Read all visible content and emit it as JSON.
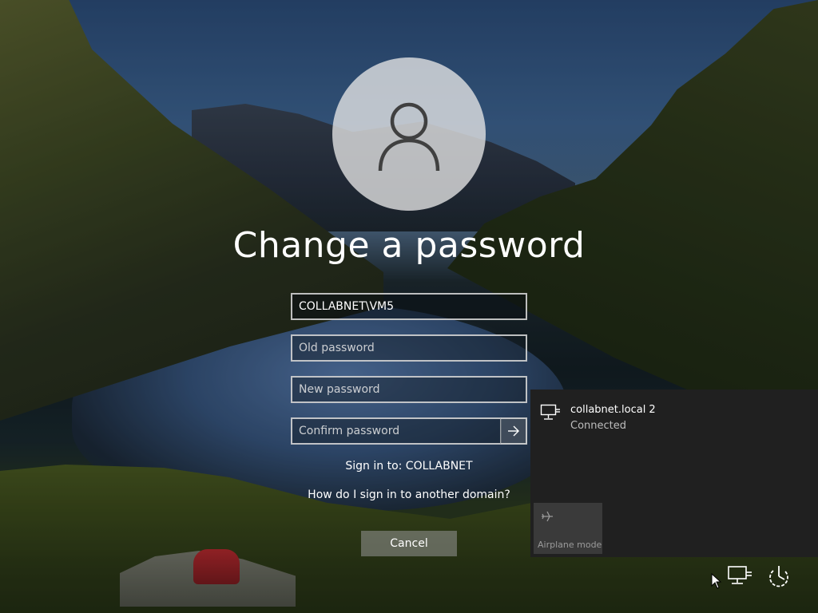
{
  "title": "Change a password",
  "form": {
    "username_value": "COLLABNET\\VM5",
    "old_password_placeholder": "Old password",
    "new_password_placeholder": "New password",
    "confirm_password_placeholder": "Confirm password",
    "submit_icon": "arrow-right-icon"
  },
  "sign_in_to": "Sign in to: COLLABNET",
  "domain_help_link": "How do I sign in to another domain?",
  "cancel_label": "Cancel",
  "network_flyout": {
    "network_name": "collabnet.local 2",
    "network_status": "Connected",
    "network_icon": "ethernet-icon",
    "airplane_mode_label": "Airplane mode",
    "airplane_icon": "airplane-icon"
  },
  "tray": {
    "network_icon": "network-icon",
    "power_icon": "power-icon"
  },
  "colors": {
    "flyout_background": "#202020",
    "tile_background": "#3a3a3a",
    "text": "#ffffff"
  }
}
